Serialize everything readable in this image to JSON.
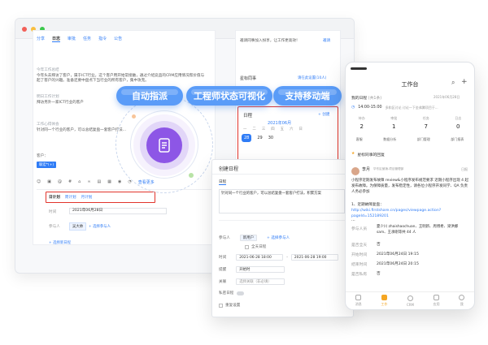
{
  "colors": {
    "accent": "#2f7cf6",
    "highlight": "#e2342b",
    "pill": "#5a9cf8",
    "center": "#8d56e6",
    "star": "#f5a623"
  },
  "left_panel": {
    "tabs": [
      "分享",
      "日志",
      "审批",
      "任务",
      "指令",
      "公告"
    ],
    "feed": [
      {
        "title": "今年工作总结",
        "text": "今年头去拜访了客户，属于ICT行业。这个客户用开始常接触，通过介绍竞品的CRM应用情况帮价值与起了客户的兴趣。准备还要中盘点下当行业的所有客户，集中攻克。"
      },
      {
        "title": "明日工作计划",
        "text": "拜访另外一家ICT行业的客户"
      },
      {
        "title": "工作心得体会",
        "text": "针对同一个行业的客户，可以总结复盘一套客户打法..."
      }
    ],
    "customer_label": "客户：",
    "customer_tag": "联宏*(+)",
    "toolbar_right": "查看更多",
    "subtabs": [
      "日计划",
      "周计划",
      "月计划"
    ],
    "time_label": "时间",
    "time_value": "2021年06月28日",
    "participants_label": "参与人",
    "participant_name": "吴大帅",
    "add_participant": "+ 选择参与人",
    "add_schedule": "+ 选择新日程"
  },
  "right_panel": {
    "notice": "邀请同事加入纷享，让工作更高效！",
    "notice_link": "邀请",
    "star_title": "星标同事",
    "star_link": "请在此设置(10人)",
    "calendar_title": "日程",
    "calendar_create": "+ 创建",
    "calendar_month": "2021年06月",
    "weekdays": [
      "一",
      "二",
      "三",
      "四",
      "五",
      "六",
      "日"
    ],
    "dates": [
      "28",
      "29",
      "30",
      "",
      "",
      "",
      ""
    ]
  },
  "pills": [
    "自动指派",
    "工程师状态可视化",
    "支持移动端"
  ],
  "modal": {
    "title": "创建日程",
    "section": "日程",
    "placeholder": "针对同一个行业的客户，可以总结复盘一套客户打法，积累方案",
    "participants_label": "参与人",
    "participant_tag": "新用户",
    "add_participant": "+ 选择参与人",
    "all_day_label": "全天日程",
    "time_label": "时间",
    "time_start": "2021-06-28 18:00",
    "time_end": "2021-06-28 19:00",
    "remind_label": "提醒",
    "remind_value": "开始时",
    "related_label": "关联",
    "related_value": "选择关联（非必填）",
    "private_label": "私密日程",
    "repeat_label": "重复设置"
  },
  "phone": {
    "title": "工作台",
    "my_schedule": "我的日程",
    "schedule_count": "(共1条)",
    "schedule_date": "2021年06月28日",
    "schedule_time": "14:00-15:00",
    "schedule_text": "多和区讨论 讨论一下金弗腾项目于...",
    "stats": [
      {
        "label": "待办",
        "value": "2"
      },
      {
        "label": "审批",
        "value": "1"
      },
      {
        "label": "任务",
        "value": "7"
      },
      {
        "label": "日志",
        "value": "0"
      }
    ],
    "links": [
      "客服",
      "数据分析",
      "部门管理",
      "部门报表"
    ],
    "star_group": "星标同事的回复",
    "poster": "李月",
    "poster_dept": "华东区营销-项目管理部",
    "poster_tag": "日报",
    "post_body": "小程序近期发布故障 review&小程序发布规范要求 近期小程序出现 4 起发布故障。为保障质量，发布稳定性，请各位小程序开发同学、QA 负责人务必参加",
    "item1": "1、近期故障复盘：",
    "item1_link": "http://wiki.firstshare.cn/pages/viewpage.action?pageId=152189201",
    "more": "...",
    "participants_label": "参与人员",
    "participants": "夏少川 zhaishaochuan、王明新、周博希、梁洪娜 sam、王承刚等共 44 人",
    "allday_label": "是否全天",
    "allday_value": "否",
    "start_label": "开始时间",
    "start_value": "2021年06月24日 19:15",
    "end_label": "结束时间",
    "end_value": "2021年06月24日 20:15",
    "private_label": "是否私有",
    "private_value": "否",
    "tabbar": [
      "消息",
      "工作",
      "CRM",
      "应用",
      "我"
    ]
  }
}
